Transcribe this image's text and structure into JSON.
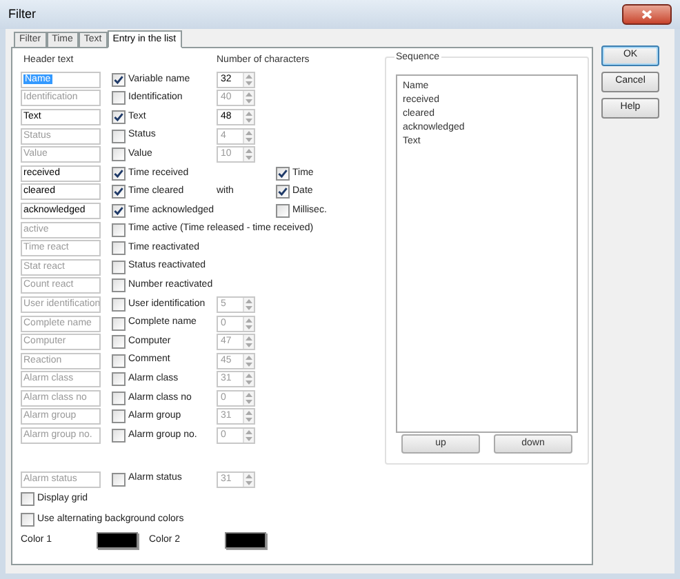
{
  "window": {
    "title": "Filter"
  },
  "tabs": [
    {
      "label": "Filter",
      "selected": false
    },
    {
      "label": "Time",
      "selected": false
    },
    {
      "label": "Text",
      "selected": false
    },
    {
      "label": "Entry in the list",
      "selected": true
    }
  ],
  "header_text_label": "Header text",
  "count_label": "Number of characters",
  "rows": [
    {
      "header": "Name",
      "header_selected": true,
      "label": "Variable name",
      "checked": true,
      "count": "32"
    },
    {
      "header": "Identification",
      "header_selected": false,
      "label": "Identification",
      "checked": false,
      "count": "40"
    },
    {
      "header": "Text",
      "header_selected": false,
      "label": "Text",
      "checked": true,
      "count": "48"
    },
    {
      "header": "Status",
      "header_selected": false,
      "label": "Status",
      "checked": false,
      "count": "4"
    },
    {
      "header": "Value",
      "header_selected": false,
      "label": "Value",
      "checked": false,
      "count": "10"
    },
    {
      "header": "received",
      "header_selected": false,
      "label": "Time received",
      "checked": true,
      "option": {
        "label": "Time",
        "checked": true
      }
    },
    {
      "header": "cleared",
      "header_selected": false,
      "label": "Time cleared",
      "checked": true,
      "with": "with",
      "option": {
        "label": "Date",
        "checked": true
      }
    },
    {
      "header": "acknowledged",
      "header_selected": false,
      "label": "Time acknowledged",
      "checked": true,
      "option": {
        "label": "Millisec.",
        "checked": false
      }
    },
    {
      "header": "active",
      "header_selected": false,
      "label": "Time active (Time released - time received)",
      "checked": false
    },
    {
      "header": "Time react",
      "header_selected": false,
      "label": "Time reactivated",
      "checked": false
    },
    {
      "header": "Stat react",
      "header_selected": false,
      "label": "Status reactivated",
      "checked": false
    },
    {
      "header": "Count react",
      "header_selected": false,
      "label": "Number reactivated",
      "checked": false
    },
    {
      "header": "User identification",
      "header_selected": false,
      "label": "User identification",
      "checked": false,
      "count": "5"
    },
    {
      "header": "Complete name",
      "header_selected": false,
      "label": "Complete name",
      "checked": false,
      "count": "0"
    },
    {
      "header": "Computer",
      "header_selected": false,
      "label": "Computer",
      "checked": false,
      "count": "47"
    },
    {
      "header": "Reaction",
      "header_selected": false,
      "label": "Comment",
      "checked": false,
      "count": "45"
    },
    {
      "header": "Alarm class",
      "header_selected": false,
      "label": "Alarm class",
      "checked": false,
      "count": "31"
    },
    {
      "header": "Alarm class no",
      "header_selected": false,
      "label": "Alarm class no",
      "checked": false,
      "count": "0"
    },
    {
      "header": "Alarm group",
      "header_selected": false,
      "label": "Alarm group",
      "checked": false,
      "count": "31"
    },
    {
      "header": "Alarm group no.",
      "header_selected": false,
      "label": "Alarm group no.",
      "checked": false,
      "count": "0"
    }
  ],
  "status_row": {
    "header": "Alarm status",
    "header_selected": false,
    "label": "Alarm status",
    "checked": false,
    "count": "31"
  },
  "display_grid": {
    "label": "Display grid",
    "checked": false
  },
  "alternating_colors": {
    "label": "Use alternating background colors",
    "checked": false
  },
  "colors": [
    {
      "label": "Color 1",
      "color": "#000000"
    },
    {
      "label": "Color 2",
      "color": "#000000"
    }
  ],
  "sequence": {
    "title": "Sequence",
    "items": [
      "Name",
      "received",
      "cleared",
      "acknowledged",
      "Text"
    ],
    "buttons": [
      "up",
      "down"
    ]
  },
  "buttons": [
    {
      "label": "OK",
      "default": true
    },
    {
      "label": "Cancel",
      "default": false
    },
    {
      "label": "Help",
      "default": false
    }
  ]
}
